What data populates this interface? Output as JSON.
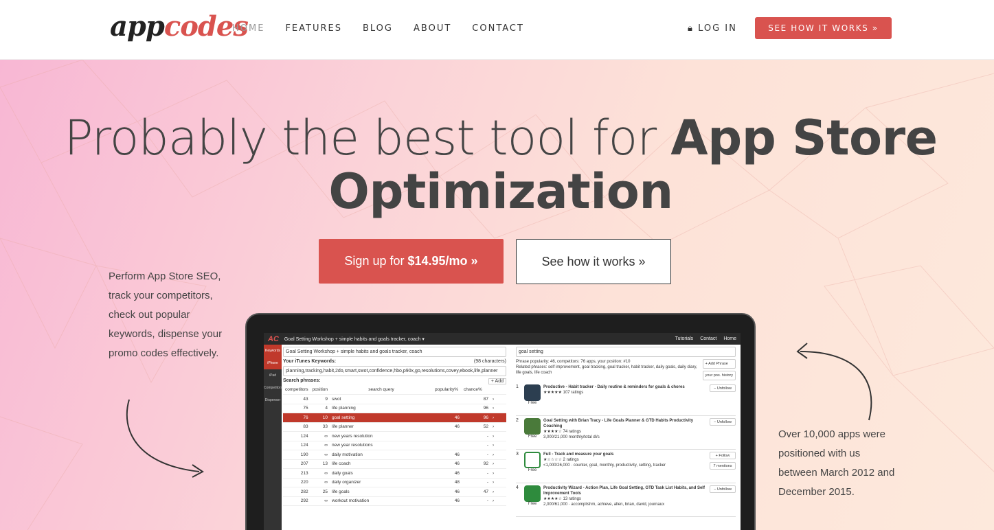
{
  "nav": {
    "logo_part1": "app",
    "logo_part2": "codes",
    "links": [
      "HOME",
      "FEATURES",
      "BLOG",
      "ABOUT",
      "CONTACT"
    ],
    "login": "LOG IN",
    "cta": "SEE HOW IT WORKS »"
  },
  "hero": {
    "headline_light": "Probably the best tool for ",
    "headline_bold1": "App Store",
    "headline_bold2": "Optimization",
    "signup_prefix": "Sign up for",
    "signup_price": "$14.95/mo »",
    "see_how": "See how it works »",
    "left_text": "Perform App Store SEO, track your competitors, check out popular keywords, dispense your promo codes effectively.",
    "right_text": "Over 10,000 apps were positioned with us between March 2012 and December 2015."
  },
  "screen": {
    "app_title": "Goal Setting Workshop + simple habits and goals tracker, coach ▾",
    "menu": [
      "Tutorials",
      "Contact",
      "Home"
    ],
    "sidebar": [
      "Keywords",
      "iPhone",
      "iPad",
      "Competitors",
      "Dispenser"
    ],
    "app_name_field": "Goal Setting Workshop + simple habits and goals tracker, coach",
    "keywords_label": "Your iTunes Keywords:",
    "keywords_count": "(98 characters)",
    "keywords_value": "planning,tracking,habit,2do,smart,swot,confidence,hbo,p90x,go,resolutions,covey,ebook,life,planner",
    "search_phrases_label": "Search phrases:",
    "add_label": "+ Add",
    "headers": [
      "competitors",
      "position",
      "search query",
      "popularity%",
      "chance%"
    ],
    "rows": [
      [
        "43",
        "9",
        "swot",
        "",
        "87"
      ],
      [
        "75",
        "4",
        "life planning",
        "",
        "96"
      ],
      [
        "76",
        "10",
        "goal setting",
        "46",
        "96"
      ],
      [
        "83",
        "33",
        "life planner",
        "46",
        "52"
      ],
      [
        "124",
        "∞",
        "new years resolution",
        "",
        "-"
      ],
      [
        "124",
        "∞",
        "new year resolutions",
        "",
        "-"
      ],
      [
        "190",
        "∞",
        "daily motivation",
        "46",
        "-"
      ],
      [
        "207",
        "13",
        "life coach",
        "46",
        "92"
      ],
      [
        "213",
        "∞",
        "daily goals",
        "46",
        "-"
      ],
      [
        "220",
        "∞",
        "daily organizer",
        "48",
        "-"
      ],
      [
        "282",
        "25",
        "life goals",
        "46",
        "47"
      ],
      [
        "292",
        "∞",
        "workout motivation",
        "46",
        "-"
      ]
    ],
    "search_value": "goal setting",
    "phrase_info": "Phrase popularity: 46, competitors: 76 apps, your position: #10",
    "related": "Related phrases: self improvement, goal tracking, goal tracker, habit tracker, daily goals, daily diary, life goals, life coach",
    "add_phrase": "+ Add Phrase",
    "your_pos": "your pos. history",
    "apps": [
      {
        "rank": "1",
        "title": "Productive - Habit tracker - Daily routine & reminders for goals & chores",
        "ratings": "★★★★★ 107 ratings",
        "line3": "",
        "price": "Free",
        "btn": "− Unfollow"
      },
      {
        "rank": "2",
        "title": "Goal Setting with Brian Tracy - Life Goals Planner & GTD Habits Productivity Coaching",
        "ratings": "★★★★☆ 74 ratings",
        "line3": "3,000/21,000 monthly/total dl/s",
        "price": "Free",
        "btn": "− Unfollow"
      },
      {
        "rank": "3",
        "title": "Full - Track and measure your goals",
        "ratings": "★☆☆☆☆ 2 ratings",
        "line3": "<1,000/26,000 · counter, goal, monthly, productivity, setting, tracker",
        "price": "Free",
        "btn": "+ Follow"
      },
      {
        "rank": "4",
        "title": "Productivity Wizard - Action Plan, Life Goal Setting, GTD Task List Habits, and Self Improvement Tools",
        "ratings": "★★★★☆ 13 ratings",
        "line3": "2,000/61,000 · accomplishm, achieve, allen, brian, david, journaux",
        "price": "Free",
        "btn": "− Unfollow"
      }
    ],
    "mentions": "7 mentions"
  }
}
